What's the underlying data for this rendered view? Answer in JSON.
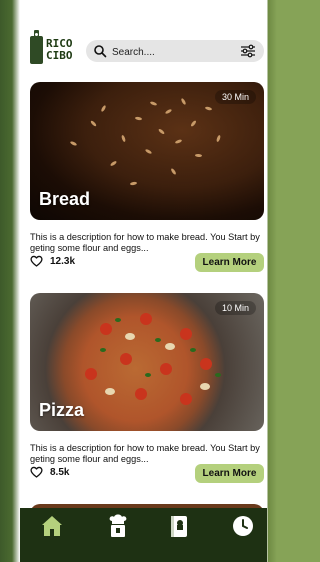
{
  "logo": {
    "line1": "RICO",
    "line2": "CIBO"
  },
  "search": {
    "placeholder": "Search...."
  },
  "recipes": [
    {
      "title": "Bread",
      "time": "30 Min",
      "description": "This is a description for how to make bread. You Start by geting some flour and eggs...",
      "likes": "12.3k",
      "button": "Learn More"
    },
    {
      "title": "Pizza",
      "time": "10 Min",
      "description": "This is a description for how to make bread. You Start by geting some flour and eggs...",
      "likes": "8.5k",
      "button": "Learn More"
    }
  ],
  "nav": [
    {
      "icon": "home-icon"
    },
    {
      "icon": "chef-icon"
    },
    {
      "icon": "recipe-book-icon"
    },
    {
      "icon": "clock-icon"
    }
  ],
  "colors": {
    "brand_dark": "#1e3113",
    "accent": "#b4d07d",
    "nav_active": "#b4d07d",
    "nav_icon": "#ffffff"
  }
}
